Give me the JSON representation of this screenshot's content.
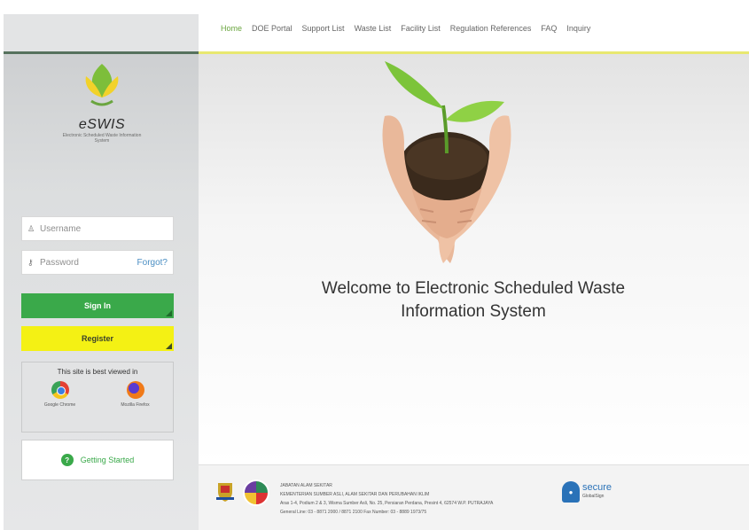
{
  "nav": {
    "items": [
      "Home",
      "DOE Portal",
      "Support List",
      "Waste List",
      "Facility List",
      "Regulation References",
      "FAQ",
      "Inquiry"
    ]
  },
  "logo": {
    "title": "eSWIS",
    "subtitle": "Electronic Scheduled Waste Information System"
  },
  "login": {
    "username_placeholder": "Username",
    "password_placeholder": "Password",
    "forgot_label": "Forgot?",
    "signin_label": "Sign In",
    "register_label": "Register"
  },
  "browsers": {
    "title": "This site is best viewed in",
    "items": [
      "Google Chrome",
      "Mozilla Firefox"
    ]
  },
  "getting_started": "Getting Started",
  "main": {
    "welcome_line1": "Welcome to Electronic Scheduled Waste",
    "welcome_line2": "Information System"
  },
  "footer": {
    "lines": [
      "JABATAN ALAM SEKITAR",
      "KEMENTERIAN SUMBER ASLI, ALAM SEKITAR DAN PERUBAHAN IKLIM",
      "Aras 1-4, Podium 2 & 3, Wisma Sumber Asli, No. 25, Persiaran Perdana, Presint 4, 62574 W.P. PUTRAJAYA",
      "General Line: 03 - 8871 2000 / 8871 2100   Fax Number: 03 - 8889 1973/75"
    ],
    "secure_label": "secure",
    "secure_sub": "GlobalSign"
  },
  "colors": {
    "signin": "#3aa94a",
    "register": "#f4f114",
    "nav_active": "#6aa53f",
    "nav_rule": "#e8e870",
    "sidebar_rule": "#56725d"
  }
}
